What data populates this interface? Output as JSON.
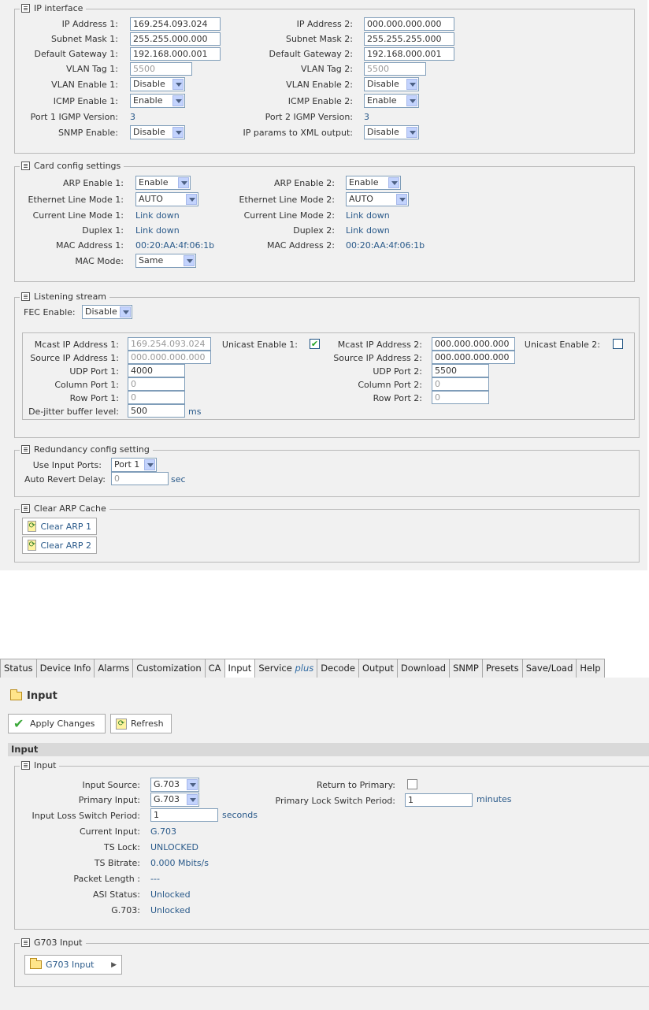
{
  "ip_interface": {
    "title": "IP interface",
    "left": [
      {
        "label": "IP Address 1:",
        "value": "169.254.093.024"
      },
      {
        "label": "Subnet Mask 1:",
        "value": "255.255.000.000"
      },
      {
        "label": "Default Gateway 1:",
        "value": "192.168.000.001"
      },
      {
        "label": "VLAN Tag 1:",
        "value": "5500"
      },
      {
        "label": "VLAN Enable 1:",
        "value": "Disable"
      },
      {
        "label": "ICMP Enable 1:",
        "value": "Enable"
      },
      {
        "label": "Port 1 IGMP Version:",
        "value": "3"
      },
      {
        "label": "SNMP Enable:",
        "value": "Disable"
      }
    ],
    "right": [
      {
        "label": "IP Address 2:",
        "value": "000.000.000.000"
      },
      {
        "label": "Subnet Mask 2:",
        "value": "255.255.255.000"
      },
      {
        "label": "Default Gateway 2:",
        "value": "192.168.000.001"
      },
      {
        "label": "VLAN Tag 2:",
        "value": "5500"
      },
      {
        "label": "VLAN Enable 2:",
        "value": "Disable"
      },
      {
        "label": "ICMP Enable 2:",
        "value": "Enable"
      },
      {
        "label": "Port 2 IGMP Version:",
        "value": "3"
      },
      {
        "label": "IP params to XML output:",
        "value": "Disable"
      }
    ]
  },
  "card_config": {
    "title": "Card config settings",
    "left": [
      {
        "label": "ARP Enable 1:",
        "value": "Enable"
      },
      {
        "label": "Ethernet Line Mode 1:",
        "value": "AUTO"
      },
      {
        "label": "Current Line Mode 1:",
        "value": "Link down"
      },
      {
        "label": "Duplex 1:",
        "value": "Link down"
      },
      {
        "label": "MAC Address 1:",
        "value": "00:20:AA:4f:06:1b"
      },
      {
        "label": "MAC Mode:",
        "value": "Same"
      }
    ],
    "right": [
      {
        "label": "ARP Enable 2:",
        "value": "Enable"
      },
      {
        "label": "Ethernet Line Mode 2:",
        "value": "AUTO"
      },
      {
        "label": "Current Line Mode 2:",
        "value": "Link down"
      },
      {
        "label": "Duplex 2:",
        "value": "Link down"
      },
      {
        "label": "MAC Address 2:",
        "value": "00:20:AA:4f:06:1b"
      }
    ]
  },
  "listening": {
    "title": "Listening stream",
    "fec_label": "FEC Enable:",
    "fec_value": "Disable",
    "left": [
      {
        "label": "Mcast IP Address 1:",
        "value": "169.254.093.024"
      },
      {
        "label": "Source IP Address 1:",
        "value": "000.000.000.000"
      },
      {
        "label": "UDP Port 1:",
        "value": "4000"
      },
      {
        "label": "Column Port 1:",
        "value": "0"
      },
      {
        "label": "Row Port 1:",
        "value": "0"
      },
      {
        "label": "De-jitter buffer level:",
        "value": "500"
      }
    ],
    "right": [
      {
        "label": "Mcast IP Address 2:",
        "value": "000.000.000.000"
      },
      {
        "label": "Source IP Address 2:",
        "value": "000.000.000.000"
      },
      {
        "label": "UDP Port 2:",
        "value": "5500"
      },
      {
        "label": "Column Port 2:",
        "value": "0"
      },
      {
        "label": "Row Port 2:",
        "value": "0"
      }
    ],
    "unicast1_label": "Unicast Enable 1:",
    "unicast1_checked": true,
    "unicast2_label": "Unicast Enable 2:",
    "unicast2_checked": false,
    "ms_unit": "ms"
  },
  "redundancy": {
    "title": "Redundancy config setting",
    "ports_label": "Use Input Ports:",
    "ports_value": "Port 1",
    "delay_label": "Auto Revert Delay:",
    "delay_value": "0",
    "delay_unit": "sec"
  },
  "arp_cache": {
    "title": "Clear ARP Cache",
    "btn1": "Clear ARP 1",
    "btn2": "Clear ARP 2"
  },
  "tabs": [
    {
      "label": "Status"
    },
    {
      "label": "Device Info"
    },
    {
      "label": "Alarms"
    },
    {
      "label": "Customization"
    },
    {
      "label": "CA"
    },
    {
      "label": "Input",
      "active": true
    },
    {
      "label": "Service ",
      "suffix": "plus"
    },
    {
      "label": "Decode"
    },
    {
      "label": "Output"
    },
    {
      "label": "Download"
    },
    {
      "label": "SNMP"
    },
    {
      "label": "Presets"
    },
    {
      "label": "Save/Load"
    },
    {
      "label": "Help"
    }
  ],
  "input_page": {
    "heading": "Input",
    "apply_label": "Apply Changes",
    "refresh_label": "Refresh",
    "section_title": "Input",
    "box_title": "Input",
    "input_source_label": "Input Source:",
    "input_source_value": "G.703",
    "primary_input_label": "Primary Input:",
    "primary_input_value": "G.703",
    "loss_switch_label": "Input Loss Switch Period:",
    "loss_switch_value": "1",
    "loss_switch_unit": "seconds",
    "return_primary_label": "Return to Primary:",
    "return_primary_checked": false,
    "primary_lock_label": "Primary Lock Switch Period:",
    "primary_lock_value": "1",
    "primary_lock_unit": "minutes",
    "status": [
      {
        "label": "Current Input:",
        "value": "G.703"
      },
      {
        "label": "TS Lock:",
        "value": "UNLOCKED"
      },
      {
        "label": "TS Bitrate:",
        "value": "0.000 Mbits/s"
      },
      {
        "label": "Packet Length :",
        "value": "---"
      },
      {
        "label": "ASI Status:",
        "value": "Unlocked"
      },
      {
        "label": "G.703:",
        "value": "Unlocked"
      }
    ],
    "g703_box_title": "G703 Input",
    "g703_button": "G703 Input"
  }
}
